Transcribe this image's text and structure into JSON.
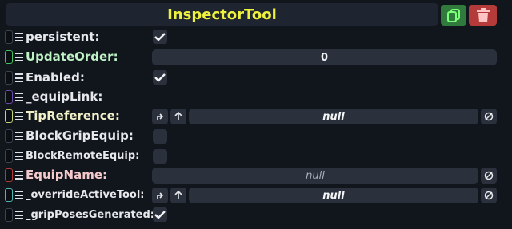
{
  "header": {
    "title": "InspectorTool",
    "duplicate_icon": "duplicate-icon",
    "delete_icon": "trash-icon"
  },
  "rows": [
    {
      "label": "persistent:",
      "tag_color": "#3c4250",
      "label_color": "#e6e8ec",
      "checked": true
    },
    {
      "label": "UpdateOrder:",
      "tag_color": "#3fc461",
      "label_color": "#bff3c6",
      "value": "0"
    },
    {
      "label": "Enabled:",
      "tag_color": "#3c4250",
      "label_color": "#e6e8ec",
      "checked": true
    },
    {
      "label": "_equipLink:",
      "tag_color": "#6b4aa8",
      "label_color": "#e6e8ec"
    },
    {
      "label": "TipReference:",
      "tag_color": "#c9d47a",
      "label_color": "#f2f0c8",
      "value": "null"
    },
    {
      "label": "BlockGripEquip:",
      "tag_color": "#3c4250",
      "label_color": "#e6e8ec",
      "checked": false
    },
    {
      "label": "BlockRemoteEquip:",
      "tag_color": "#3c4250",
      "label_color": "#e6e8ec",
      "checked": false
    },
    {
      "label": "EquipName:",
      "tag_color": "#b03a3a",
      "label_color": "#f3c9cc",
      "value": "null"
    },
    {
      "label": "_overrideActiveTool:",
      "tag_color": "#4fb6b0",
      "label_color": "#e6e8ec",
      "value": "null"
    },
    {
      "label": "_gripPosesGenerated:",
      "tag_color": "#3c4250",
      "label_color": "#e6e8ec",
      "checked": true
    }
  ]
}
